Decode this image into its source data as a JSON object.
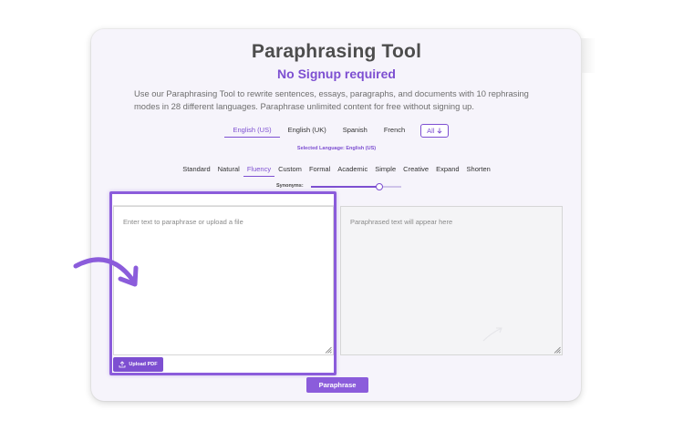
{
  "header": {
    "title": "Paraphrasing Tool",
    "subtitle": "No Signup required",
    "description": "Use our Paraphrasing Tool to rewrite sentences, essays, paragraphs, and documents with 10 rephrasing modes in 28 different languages. Paraphrase unlimited content for free without signing up."
  },
  "languages": {
    "items": [
      "English (US)",
      "English (UK)",
      "Spanish",
      "French"
    ],
    "active_index": 0,
    "all_label": "All",
    "selected_text": "Selected Language: English (US)"
  },
  "modes": {
    "items": [
      "Standard",
      "Natural",
      "Fluency",
      "Custom",
      "Formal",
      "Academic",
      "Simple",
      "Creative",
      "Expand",
      "Shorten"
    ],
    "active_index": 2
  },
  "synonyms": {
    "label": "Synonyms:",
    "level": 0.76
  },
  "editor": {
    "input_placeholder": "Enter text to paraphrase or upload a file",
    "output_placeholder": "Paraphrased text will appear here",
    "upload_label": "Upload PDF",
    "paraphrase_label": "Paraphrase"
  },
  "colors": {
    "accent": "#7d4fd1",
    "highlight": "#8b5cdb"
  },
  "icons": {
    "upload": "upload-icon",
    "all_dropdown": "arrow-down-icon",
    "callout": "curved-arrow-icon"
  }
}
